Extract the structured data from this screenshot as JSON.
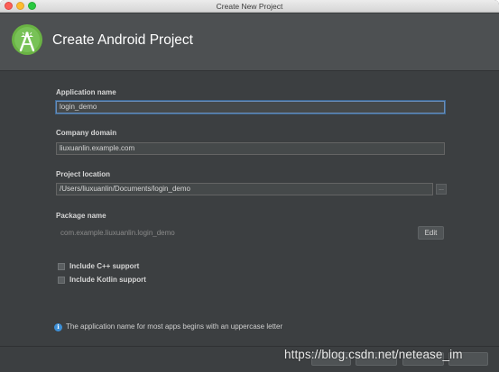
{
  "window": {
    "title": "Create New Project"
  },
  "header": {
    "title": "Create Android Project",
    "logo_icon": "android-studio-logo-icon",
    "background": "#4d5052"
  },
  "form": {
    "application_name": {
      "label": "Application name",
      "value": "login_demo"
    },
    "company_domain": {
      "label": "Company domain",
      "value": "liuxuanlin.example.com"
    },
    "project_location": {
      "label": "Project location",
      "value": "/Users/liuxuanlin/Documents/login_demo",
      "browse_label": "..."
    },
    "package_name": {
      "label": "Package name",
      "value": "com.example.liuxuanlin.login_demo",
      "edit_label": "Edit"
    },
    "checkboxes": [
      {
        "label": "Include C++ support",
        "checked": false
      },
      {
        "label": "Include Kotlin support",
        "checked": false
      }
    ]
  },
  "hint": {
    "icon": "info-icon",
    "text": "The application name for most apps begins with an uppercase letter"
  },
  "watermark": {
    "text": "https://blog.csdn.net/netease_im"
  },
  "colors": {
    "background": "#3c3f41",
    "accent_focus": "#6a8db8",
    "info_blue": "#3d8fd6"
  }
}
